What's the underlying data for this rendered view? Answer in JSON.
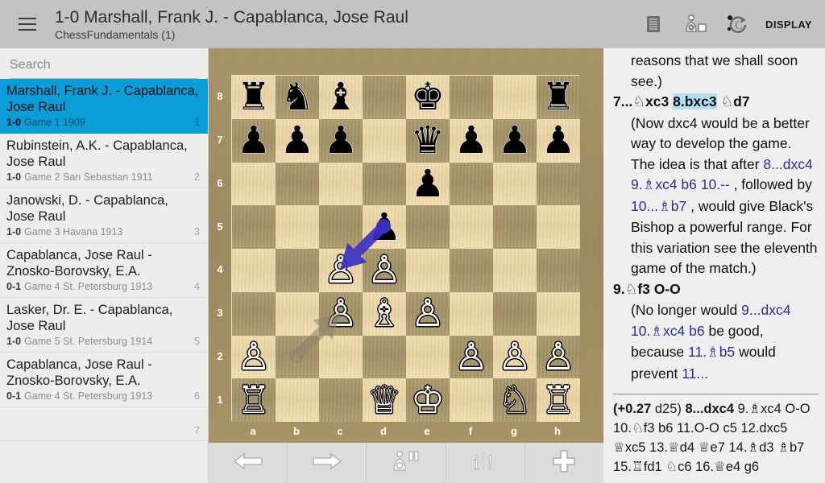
{
  "header": {
    "title": "1-0 Marshall, Frank J. - Capablanca, Jose Raul",
    "subtitle": "ChessFundamentals (1)",
    "menu_icon": "hamburger-menu-icon",
    "icons": [
      {
        "name": "notes-list-icon"
      },
      {
        "name": "engine-pawn-gear-icon"
      },
      {
        "name": "analysis-rotate-icon"
      }
    ],
    "display_label": "DISPLAY"
  },
  "sidebar": {
    "search": {
      "placeholder": "Search",
      "value": ""
    },
    "games": [
      {
        "title": "Marshall, Frank J. - Capablanca, Jose Raul",
        "result": "1-0",
        "info": "Game 1 1909",
        "num": "1",
        "selected": true
      },
      {
        "title": "Rubinstein, A.K. - Capablanca, Jose Raul",
        "result": "1-0",
        "info": "Game 2 San Sebastian 1911",
        "num": "2",
        "selected": false
      },
      {
        "title": "Janowski, D. - Capablanca, Jose Raul",
        "result": "1-0",
        "info": "Game 3 Havana 1913",
        "num": "3",
        "selected": false
      },
      {
        "title": "Capablanca, Jose Raul - Znosko-Borovsky, E.A.",
        "result": "0-1",
        "info": "Game 4 St. Petersburg 1913",
        "num": "4",
        "selected": false
      },
      {
        "title": "Lasker, Dr. E. - Capablanca, Jose Raul",
        "result": "1-0",
        "info": "Game 5 St. Petersburg 1914",
        "num": "5",
        "selected": false
      },
      {
        "title": "Capablanca, Jose Raul - Znosko-Borovsky, E.A.",
        "result": "0-1",
        "info": "Game 4 St. Petersburg 1913",
        "num": "6",
        "selected": false
      },
      {
        "title": "",
        "result": "",
        "info": "",
        "num": "7",
        "selected": false
      }
    ]
  },
  "board": {
    "files": [
      "a",
      "b",
      "c",
      "d",
      "e",
      "f",
      "g",
      "h"
    ],
    "ranks": [
      "8",
      "7",
      "6",
      "5",
      "4",
      "3",
      "2",
      "1"
    ],
    "light_square_color": "#efdbad",
    "dark_square_color": "#a89567",
    "pieces": [
      {
        "sq": "a8",
        "piece": "r",
        "color": "black",
        "glyph": "♜"
      },
      {
        "sq": "b8",
        "piece": "n",
        "color": "black",
        "glyph": "♞"
      },
      {
        "sq": "c8",
        "piece": "b",
        "color": "black",
        "glyph": "♝"
      },
      {
        "sq": "e8",
        "piece": "k",
        "color": "black",
        "glyph": "♚"
      },
      {
        "sq": "h8",
        "piece": "r",
        "color": "black",
        "glyph": "♜"
      },
      {
        "sq": "a7",
        "piece": "p",
        "color": "black",
        "glyph": "♟"
      },
      {
        "sq": "b7",
        "piece": "p",
        "color": "black",
        "glyph": "♟"
      },
      {
        "sq": "c7",
        "piece": "p",
        "color": "black",
        "glyph": "♟"
      },
      {
        "sq": "e7",
        "piece": "q",
        "color": "black",
        "glyph": "♛"
      },
      {
        "sq": "f7",
        "piece": "p",
        "color": "black",
        "glyph": "♟"
      },
      {
        "sq": "g7",
        "piece": "p",
        "color": "black",
        "glyph": "♟"
      },
      {
        "sq": "h7",
        "piece": "p",
        "color": "black",
        "glyph": "♟"
      },
      {
        "sq": "e6",
        "piece": "p",
        "color": "black",
        "glyph": "♟"
      },
      {
        "sq": "d5",
        "piece": "p",
        "color": "black",
        "glyph": "♟"
      },
      {
        "sq": "c4",
        "piece": "p",
        "color": "white",
        "glyph": "♙"
      },
      {
        "sq": "d4",
        "piece": "p",
        "color": "white",
        "glyph": "♙"
      },
      {
        "sq": "c3",
        "piece": "p",
        "color": "white",
        "glyph": "♙"
      },
      {
        "sq": "d3",
        "piece": "b",
        "color": "white",
        "glyph": "♗"
      },
      {
        "sq": "e3",
        "piece": "p",
        "color": "white",
        "glyph": "♙"
      },
      {
        "sq": "a2",
        "piece": "p",
        "color": "white",
        "glyph": "♙"
      },
      {
        "sq": "f2",
        "piece": "p",
        "color": "white",
        "glyph": "♙"
      },
      {
        "sq": "g2",
        "piece": "p",
        "color": "white",
        "glyph": "♙"
      },
      {
        "sq": "h2",
        "piece": "p",
        "color": "white",
        "glyph": "♙"
      },
      {
        "sq": "a1",
        "piece": "r",
        "color": "white",
        "glyph": "♖"
      },
      {
        "sq": "d1",
        "piece": "q",
        "color": "white",
        "glyph": "♕"
      },
      {
        "sq": "e1",
        "piece": "k",
        "color": "white",
        "glyph": "♔"
      },
      {
        "sq": "g1",
        "piece": "n",
        "color": "white",
        "glyph": "♘"
      },
      {
        "sq": "h1",
        "piece": "r",
        "color": "white",
        "glyph": "♖"
      }
    ],
    "arrows": [
      {
        "name": "engine-suggestion-arrow",
        "from": "d5",
        "to": "c4",
        "color": "#3b31c4"
      },
      {
        "name": "last-move-arrow",
        "from": "b2",
        "to": "c3",
        "color": "#8a7f6a"
      }
    ]
  },
  "toolbar": {
    "buttons": [
      {
        "name": "previous-move-button",
        "icon": "left-arrow-icon"
      },
      {
        "name": "next-move-button",
        "icon": "right-arrow-icon"
      },
      {
        "name": "engine-pause-button",
        "icon": "pawn-pause-icon"
      },
      {
        "name": "info-annotation-button",
        "icon": "info-exclamation-icon"
      },
      {
        "name": "add-button",
        "icon": "plus-icon"
      }
    ]
  },
  "panel": {
    "lines": [
      {
        "indent": true,
        "parts": [
          {
            "t": "reasons that we shall soon see.)",
            "s": "plain"
          }
        ]
      },
      {
        "indent": false,
        "parts": [
          {
            "t": "7...",
            "s": "move"
          },
          {
            "t": "♘",
            "s": "move-fig"
          },
          {
            "t": "xc3 ",
            "s": "move"
          },
          {
            "t": "8.bxc3",
            "s": "move-hl"
          },
          {
            "t": " ",
            "s": "move"
          },
          {
            "t": "♘",
            "s": "move-fig"
          },
          {
            "t": "d7",
            "s": "move"
          }
        ]
      },
      {
        "indent": true,
        "parts": [
          {
            "t": "(Now dxc4 would be a better way to develop the game. The idea is that after ",
            "s": "plain"
          },
          {
            "t": "8...dxc4 9.",
            "s": "var"
          },
          {
            "t": "♗",
            "s": "var-fig"
          },
          {
            "t": "xc4 b6 10.--",
            "s": "var"
          },
          {
            "t": " , followed by ",
            "s": "plain"
          },
          {
            "t": "10...",
            "s": "var"
          },
          {
            "t": "♗",
            "s": "var-fig"
          },
          {
            "t": "b7",
            "s": "var"
          },
          {
            "t": " , would give Black's Bishop a powerful range. For this variation see the eleventh game of the match.)",
            "s": "plain"
          }
        ]
      },
      {
        "indent": false,
        "parts": [
          {
            "t": "9.",
            "s": "move"
          },
          {
            "t": "♘",
            "s": "move-fig"
          },
          {
            "t": "f3 O-O",
            "s": "move"
          }
        ]
      },
      {
        "indent": true,
        "parts": [
          {
            "t": "(No longer would ",
            "s": "plain"
          },
          {
            "t": "9...dxc4 10.",
            "s": "var"
          },
          {
            "t": "♗",
            "s": "var-fig"
          },
          {
            "t": "xc4 b6",
            "s": "var"
          },
          {
            "t": " be good, because ",
            "s": "plain"
          },
          {
            "t": "11.",
            "s": "var"
          },
          {
            "t": "♗",
            "s": "var-fig"
          },
          {
            "t": "b5",
            "s": "var"
          },
          {
            "t": " would prevent ",
            "s": "plain"
          },
          {
            "t": "11...",
            "s": "var"
          }
        ]
      }
    ],
    "engine": {
      "eval": "(+0.27",
      "depth": "d25)",
      "pv_first": "8...dxc4",
      "pv_rest": [
        {
          "t": " 9.",
          "s": "plain"
        },
        {
          "t": "♗",
          "s": "fig"
        },
        {
          "t": "xc4 O-O 10.",
          "s": "plain"
        },
        {
          "t": "♘",
          "s": "fig"
        },
        {
          "t": "f3 b6 11.O-O c5 12.dxc5 ",
          "s": "plain"
        },
        {
          "t": "♕",
          "s": "fig"
        },
        {
          "t": "xc5 13.",
          "s": "plain"
        },
        {
          "t": "♕",
          "s": "fig"
        },
        {
          "t": "d4 ",
          "s": "plain"
        },
        {
          "t": "♕",
          "s": "fig"
        },
        {
          "t": "e7 14.",
          "s": "plain"
        },
        {
          "t": "♗",
          "s": "fig"
        },
        {
          "t": "d3 ",
          "s": "plain"
        },
        {
          "t": "♗",
          "s": "fig"
        },
        {
          "t": "b7 15.",
          "s": "plain"
        },
        {
          "t": "♖",
          "s": "fig"
        },
        {
          "t": "fd1 ",
          "s": "plain"
        },
        {
          "t": "♘",
          "s": "fig"
        },
        {
          "t": "c6 16.",
          "s": "plain"
        },
        {
          "t": "♕",
          "s": "fig"
        },
        {
          "t": "e4 g6",
          "s": "plain"
        }
      ]
    }
  }
}
